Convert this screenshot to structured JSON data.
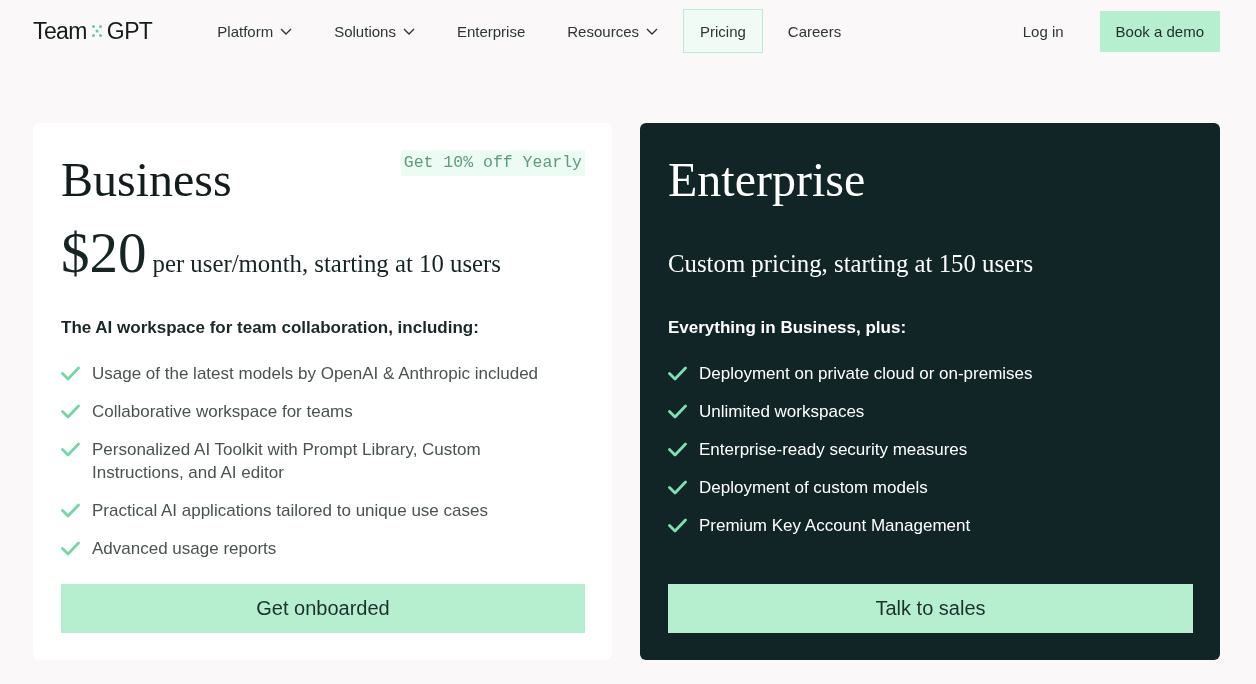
{
  "nav": {
    "logo": {
      "parts": [
        "Team",
        "GPT"
      ]
    },
    "items": [
      {
        "label": "Platform",
        "has_menu": true,
        "selected": false
      },
      {
        "label": "Solutions",
        "has_menu": true,
        "selected": false
      },
      {
        "label": "Enterprise",
        "has_menu": false,
        "selected": false
      },
      {
        "label": "Resources",
        "has_menu": true,
        "selected": false
      },
      {
        "label": "Pricing",
        "has_menu": false,
        "selected": true
      },
      {
        "label": "Careers",
        "has_menu": false,
        "selected": false
      }
    ],
    "login": "Log in",
    "cta": "Book a demo"
  },
  "plans": [
    {
      "kind": "light",
      "name": "Business",
      "badge": "Get 10% off Yearly",
      "price": "$20",
      "price_note": "per user/month, starting at 10 users",
      "features_heading": "The AI workspace for team collaboration, including:",
      "features": [
        "Usage of the latest models by OpenAI & Anthropic included",
        "Collaborative workspace for teams",
        "Personalized AI Toolkit with Prompt Library, Custom Instructions, and AI editor",
        "Practical AI applications tailored to unique use cases",
        "Advanced usage reports"
      ],
      "button": "Get onboarded"
    },
    {
      "kind": "dark",
      "name": "Enterprise",
      "price_note": "Custom pricing, starting at 150 users",
      "features_heading": "Everything in Business, plus:",
      "features": [
        "Deployment on private cloud or on-premises",
        "Unlimited workspaces",
        "Enterprise-ready security measures",
        "Deployment of custom models",
        "Premium Key Account Management"
      ],
      "button": "Talk to sales"
    }
  ]
}
